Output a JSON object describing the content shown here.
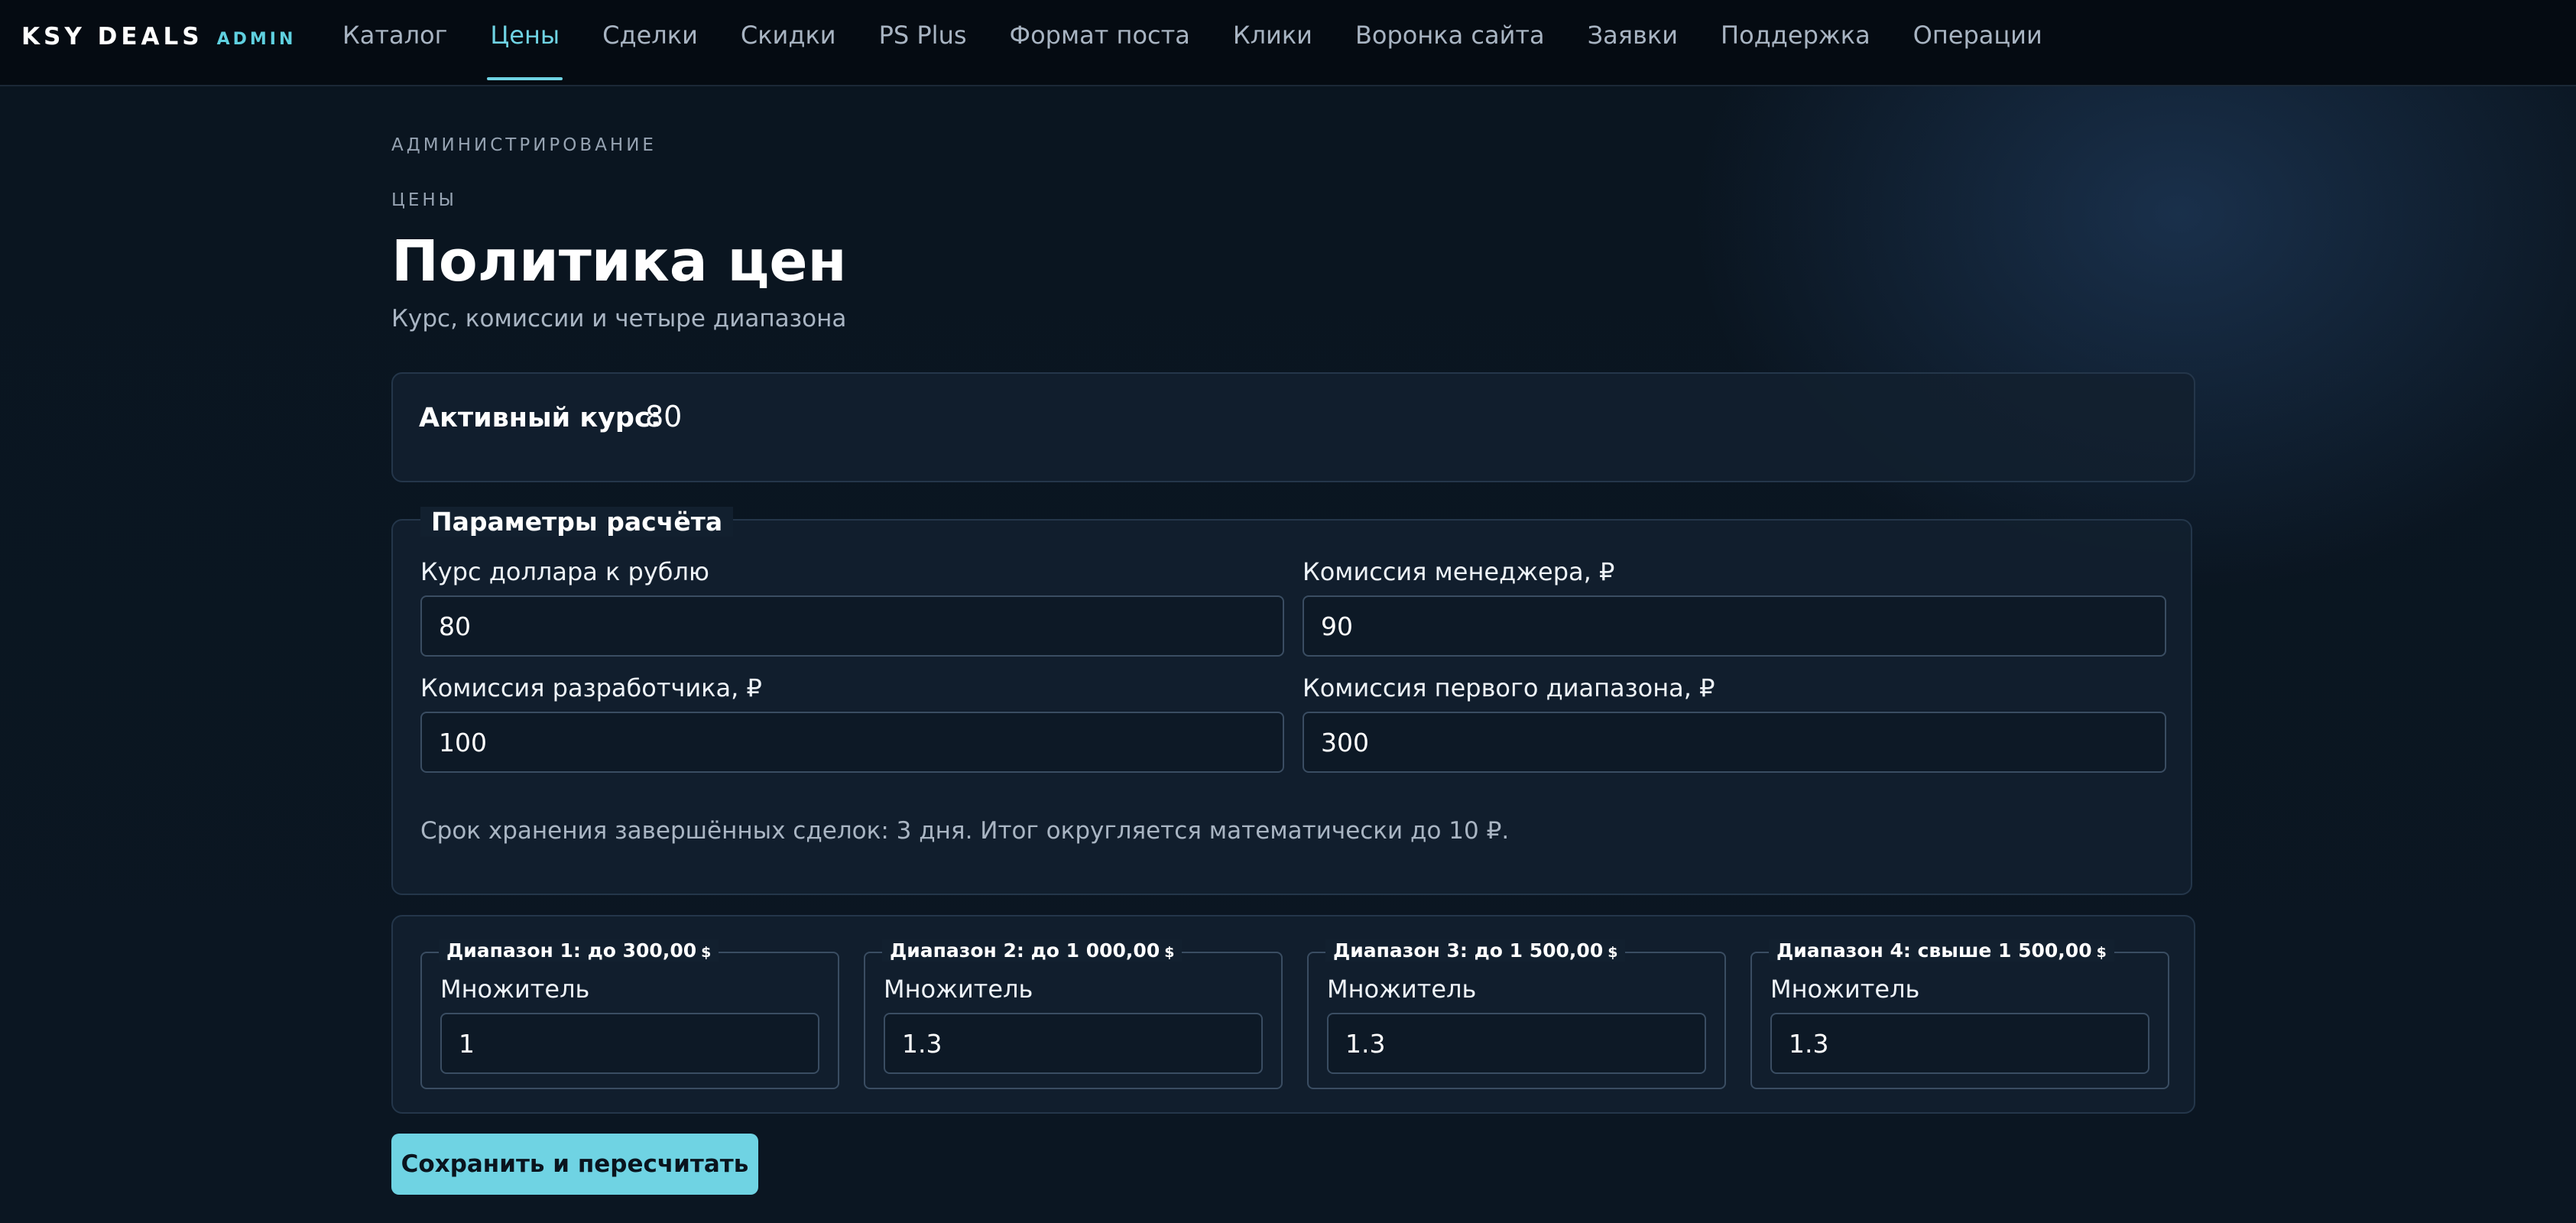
{
  "brand": {
    "name": "KSY DEALS",
    "tag": "ADMIN"
  },
  "nav": [
    {
      "label": "Каталог"
    },
    {
      "label": "Цены",
      "active": true
    },
    {
      "label": "Сделки"
    },
    {
      "label": "Скидки"
    },
    {
      "label": "PS Plus"
    },
    {
      "label": "Формат поста"
    },
    {
      "label": "Клики"
    },
    {
      "label": "Воронка сайта"
    },
    {
      "label": "Заявки"
    },
    {
      "label": "Поддержка"
    },
    {
      "label": "Операции"
    }
  ],
  "header": {
    "section": "АДМИНИСТРИРОВАНИЕ",
    "subsection": "ЦЕНЫ",
    "title": "Политика цен",
    "subtitle": "Курс, комиссии и четыре диапазона"
  },
  "rate": {
    "label": "Активный курс:",
    "value": "80"
  },
  "params": {
    "legend": "Параметры расчёта",
    "fields": {
      "usd_rate": {
        "label": "Курс доллара к рублю",
        "value": "80"
      },
      "manager_fee": {
        "label": "Комиссия менеджера, ₽",
        "value": "90"
      },
      "developer_fee": {
        "label": "Комиссия разработчика, ₽",
        "value": "100"
      },
      "first_range_fee": {
        "label": "Комиссия первого диапазона, ₽",
        "value": "300"
      }
    },
    "note": "Срок хранения завершённых сделок: 3 дня. Итог округляется математически до 10 ₽."
  },
  "ranges": [
    {
      "legend": "Диапазон 1: до 300,00",
      "currency": "$",
      "label": "Множитель",
      "value": "1"
    },
    {
      "legend": "Диапазон 2: до 1 000,00",
      "currency": "$",
      "label": "Множитель",
      "value": "1.3"
    },
    {
      "legend": "Диапазон 3: до 1 500,00",
      "currency": "$",
      "label": "Множитель",
      "value": "1.3"
    },
    {
      "legend": "Диапазон 4: свыше 1 500,00",
      "currency": "$",
      "label": "Множитель",
      "value": "1.3"
    }
  ],
  "actions": {
    "save_label": "Сохранить и пересчитать"
  },
  "colors": {
    "accent": "#6fd3e3",
    "background": "#0b141f",
    "panel": "#12202f"
  }
}
